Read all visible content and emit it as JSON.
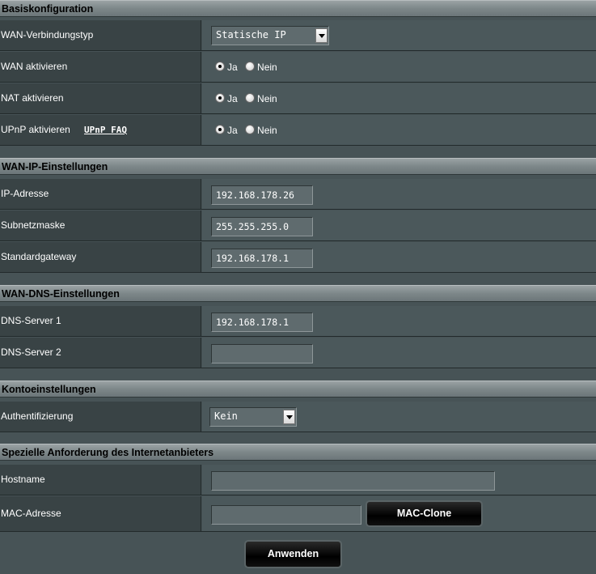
{
  "sections": {
    "basic": "Basiskonfiguration",
    "wan_ip": "WAN-IP-Einstellungen",
    "wan_dns": "WAN-DNS-Einstellungen",
    "account": "Kontoeinstellungen",
    "isp": "Spezielle Anforderung des Internetanbieters"
  },
  "basic": {
    "wan_type_label": "WAN-Verbindungstyp",
    "wan_type_value": "Statische IP",
    "wan_enable_label": "WAN aktivieren",
    "nat_enable_label": "NAT aktivieren",
    "upnp_enable_label": "UPnP aktivieren",
    "upnp_faq_link": "UPnP FAQ",
    "yes": "Ja",
    "no": "Nein"
  },
  "wan_ip": {
    "ip_label": "IP-Adresse",
    "ip_value": "192.168.178.26",
    "subnet_label": "Subnetzmaske",
    "subnet_value": "255.255.255.0",
    "gateway_label": "Standardgateway",
    "gateway_value": "192.168.178.1"
  },
  "wan_dns": {
    "dns1_label": "DNS-Server 1",
    "dns1_value": "192.168.178.1",
    "dns2_label": "DNS-Server 2",
    "dns2_value": ""
  },
  "account": {
    "auth_label": "Authentifizierung",
    "auth_value": "Kein"
  },
  "isp": {
    "hostname_label": "Hostname",
    "hostname_value": "",
    "mac_label": "MAC-Adresse",
    "mac_value": "",
    "mac_clone_button": "MAC-Clone"
  },
  "apply_button": "Anwenden"
}
